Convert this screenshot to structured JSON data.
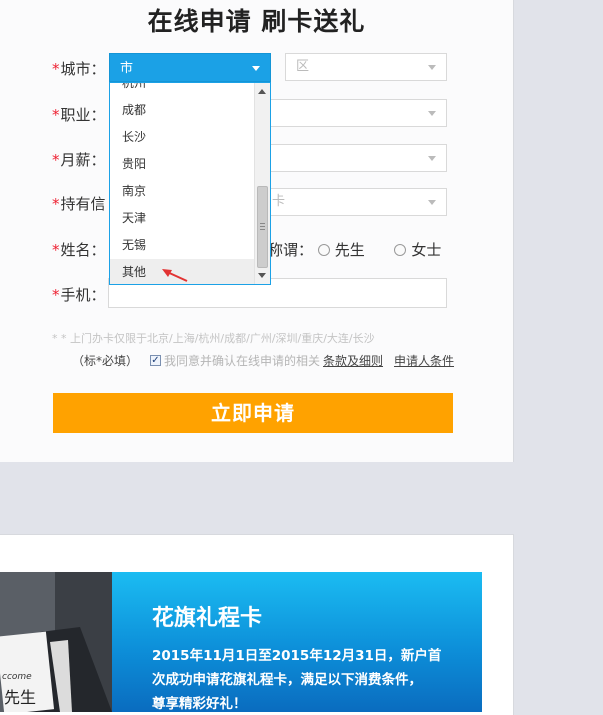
{
  "form": {
    "title": "在线申请 刷卡送礼",
    "required_mark": "*",
    "labels": {
      "city": "城市：",
      "job": "职业：",
      "salary": "月薪：",
      "card": "持有信",
      "name": "姓名：",
      "phone": "手机："
    },
    "city_value": "市",
    "district_placeholder": "区",
    "card_select_text": "卡",
    "salutation_label": "称谓：",
    "salutation_options": [
      "先生",
      "女士"
    ],
    "note": "* * 上门办卡仅限于北京/上海/杭州/成都/广州/深圳/重庆/大连/长沙",
    "required_hint": "（标*必填）",
    "agree_text": "我同意并确认在线申请的相关",
    "terms_link": "条款及细则",
    "applicant_link": "申请人条件",
    "submit_label": "立即申请"
  },
  "city_dropdown": {
    "partial_item": "杭州",
    "items": [
      "成都",
      "长沙",
      "贵阳",
      "南京",
      "天津",
      "无锡",
      "其他"
    ],
    "hovered": "其他"
  },
  "promo": {
    "title": "花旗礼程卡",
    "body_line1": "2015年11月1日至2015年12月31日，新户首",
    "body_line2": "次成功申请花旗礼程卡，满足以下消费条件，",
    "body_line3": "尊享精彩好礼！",
    "photo_text": "先生",
    "photo_text_top": "ccome"
  },
  "colors": {
    "accent": "#ffa200",
    "select_blue": "#1ba1e6",
    "required": "#e23333"
  }
}
